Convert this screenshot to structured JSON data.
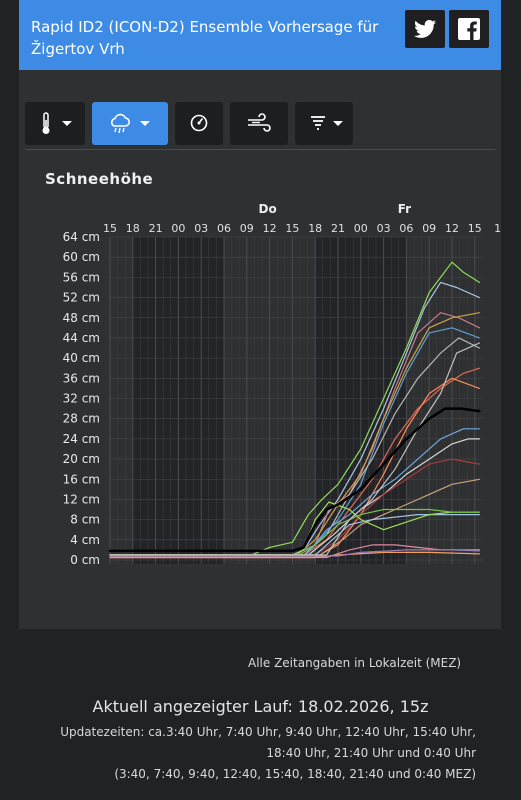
{
  "header": {
    "title": "Rapid ID2 (ICON-D2) Ensemble Vorhersage für Žigertov Vrh"
  },
  "social": {
    "twitter_icon": "twitter-icon",
    "facebook_icon": "facebook-icon"
  },
  "toolbar": {
    "items": [
      {
        "icon": "thermometer-icon",
        "active": false,
        "dropdown": true
      },
      {
        "icon": "snow-cloud-icon",
        "active": true,
        "dropdown": true
      },
      {
        "icon": "pressure-gauge-icon",
        "active": false,
        "dropdown": false
      },
      {
        "icon": "wind-icon",
        "active": false,
        "dropdown": false
      },
      {
        "icon": "gust-icon",
        "active": false,
        "dropdown": true
      }
    ],
    "accent_color": "#3e8be6"
  },
  "chart_data": {
    "type": "line",
    "title": "Schneehöhe",
    "day_labels": [
      {
        "label": "Do",
        "tick_index": 7
      },
      {
        "label": "Fr",
        "tick_index": 13
      }
    ],
    "x_ticks": [
      "15",
      "18",
      "21",
      "00",
      "03",
      "06",
      "09",
      "12",
      "15",
      "18",
      "21",
      "00",
      "03",
      "06",
      "09",
      "12",
      "15",
      "1"
    ],
    "y_ticks": [
      "0 cm",
      "4 cm",
      "8 cm",
      "12 cm",
      "16 cm",
      "20 cm",
      "24 cm",
      "28 cm",
      "32 cm",
      "36 cm",
      "40 cm",
      "44 cm",
      "48 cm",
      "52 cm",
      "56 cm",
      "60 cm",
      "64 cm"
    ],
    "ylim": [
      0,
      64
    ],
    "xlim": [
      0,
      16.3
    ],
    "grid": true,
    "series": [
      {
        "color": "#000000",
        "width": 2.5,
        "points": [
          [
            0,
            1.8
          ],
          [
            8,
            1.8
          ],
          [
            8.5,
            2.5
          ],
          [
            9,
            7
          ],
          [
            9.5,
            10
          ],
          [
            10,
            11
          ],
          [
            11,
            14
          ],
          [
            12,
            19
          ],
          [
            13,
            24
          ],
          [
            14,
            28
          ],
          [
            14.7,
            30
          ],
          [
            15.4,
            30
          ],
          [
            16.2,
            29.5
          ]
        ]
      },
      {
        "color": "#8fdc5a",
        "points": [
          [
            0,
            1
          ],
          [
            6.2,
            1
          ],
          [
            7,
            2.5
          ],
          [
            8,
            3.5
          ],
          [
            8.7,
            9
          ],
          [
            9.3,
            12
          ],
          [
            10,
            15
          ],
          [
            11,
            22
          ],
          [
            12,
            32
          ],
          [
            13,
            42
          ],
          [
            14,
            53
          ],
          [
            15,
            59
          ],
          [
            15.5,
            57
          ],
          [
            16.2,
            55
          ]
        ]
      },
      {
        "color": "#a9c4e4",
        "points": [
          [
            0,
            1
          ],
          [
            8,
            1
          ],
          [
            8.5,
            2
          ],
          [
            9.2,
            7
          ],
          [
            10,
            12
          ],
          [
            11,
            20
          ],
          [
            12,
            30
          ],
          [
            13,
            41
          ],
          [
            13.8,
            50
          ],
          [
            14.5,
            55
          ],
          [
            15.2,
            54
          ],
          [
            16.2,
            52
          ]
        ]
      },
      {
        "color": "#c77b8c",
        "points": [
          [
            0,
            1
          ],
          [
            8,
            1
          ],
          [
            9,
            3
          ],
          [
            9.6,
            10
          ],
          [
            10.5,
            13
          ],
          [
            11.5,
            22
          ],
          [
            12.5,
            34
          ],
          [
            13.5,
            45
          ],
          [
            14.5,
            49
          ],
          [
            15.3,
            48
          ],
          [
            16.2,
            46
          ]
        ]
      },
      {
        "color": "#d0a24a",
        "points": [
          [
            0,
            1
          ],
          [
            8.2,
            1
          ],
          [
            9,
            4
          ],
          [
            10,
            11
          ],
          [
            11,
            17
          ],
          [
            12,
            28
          ],
          [
            13,
            38
          ],
          [
            14,
            46
          ],
          [
            15,
            48
          ],
          [
            16.2,
            49
          ]
        ]
      },
      {
        "color": "#5f9fd0",
        "points": [
          [
            0,
            1
          ],
          [
            8,
            1
          ],
          [
            9,
            3
          ],
          [
            10,
            8
          ],
          [
            11,
            15
          ],
          [
            12,
            27
          ],
          [
            13,
            37
          ],
          [
            14,
            45
          ],
          [
            15,
            46
          ],
          [
            16.2,
            44
          ]
        ]
      },
      {
        "color": "#b8b8b8",
        "points": [
          [
            0,
            1
          ],
          [
            8.5,
            1
          ],
          [
            9.5,
            5
          ],
          [
            10.5,
            13
          ],
          [
            11.5,
            20
          ],
          [
            12.5,
            29
          ],
          [
            13.5,
            36
          ],
          [
            14.5,
            41
          ],
          [
            15.3,
            44
          ],
          [
            16.2,
            42
          ]
        ]
      },
      {
        "color": "#e06a55",
        "points": [
          [
            0,
            1
          ],
          [
            8.5,
            1
          ],
          [
            9.5,
            4
          ],
          [
            10.5,
            10
          ],
          [
            11.5,
            16
          ],
          [
            12.5,
            24
          ],
          [
            13.5,
            30
          ],
          [
            14.5,
            34
          ],
          [
            15.5,
            37
          ],
          [
            16.2,
            38
          ]
        ]
      },
      {
        "color": "#ff8a5a",
        "points": [
          [
            0,
            0.5
          ],
          [
            9,
            0.5
          ],
          [
            10,
            3
          ],
          [
            11,
            9
          ],
          [
            12,
            17
          ],
          [
            13,
            26
          ],
          [
            14,
            33
          ],
          [
            15,
            36
          ],
          [
            16.2,
            34
          ]
        ]
      },
      {
        "color": "#6fa8dc",
        "points": [
          [
            0,
            1
          ],
          [
            8.6,
            1
          ],
          [
            9.5,
            6
          ],
          [
            10.5,
            9
          ],
          [
            11.5,
            13
          ],
          [
            12.5,
            16
          ],
          [
            13.5,
            20
          ],
          [
            14.5,
            24
          ],
          [
            15.5,
            26
          ],
          [
            16.2,
            26
          ]
        ]
      },
      {
        "color": "#d8d8d8",
        "points": [
          [
            0,
            1
          ],
          [
            8.7,
            1
          ],
          [
            9.8,
            5
          ],
          [
            11,
            10
          ],
          [
            12,
            13
          ],
          [
            13,
            17
          ],
          [
            14,
            20
          ],
          [
            15,
            23
          ],
          [
            15.7,
            24
          ],
          [
            16.2,
            24
          ]
        ]
      },
      {
        "color": "#a83b3b",
        "points": [
          [
            0,
            1
          ],
          [
            9,
            1
          ],
          [
            10,
            4
          ],
          [
            11,
            9
          ],
          [
            12,
            13
          ],
          [
            13,
            16
          ],
          [
            14,
            19
          ],
          [
            15,
            20
          ],
          [
            16.2,
            19
          ]
        ]
      },
      {
        "color": "#c8a37a",
        "points": [
          [
            0,
            1
          ],
          [
            9.2,
            1
          ],
          [
            10.2,
            4
          ],
          [
            11,
            7
          ],
          [
            12,
            9
          ],
          [
            13,
            11
          ],
          [
            14,
            13
          ],
          [
            15,
            15
          ],
          [
            16.2,
            16
          ]
        ]
      },
      {
        "color": "#9ec3e6",
        "points": [
          [
            0,
            1
          ],
          [
            9,
            1
          ],
          [
            10,
            5
          ],
          [
            10.5,
            7
          ],
          [
            11.5,
            8
          ],
          [
            12.5,
            8.5
          ],
          [
            13.5,
            9
          ],
          [
            14.5,
            9
          ],
          [
            15.5,
            9
          ],
          [
            16.2,
            9
          ]
        ]
      },
      {
        "color": "#9be05a",
        "points": [
          [
            0,
            1
          ],
          [
            8,
            1
          ],
          [
            8.5,
            2
          ],
          [
            9,
            8
          ],
          [
            9.6,
            11.5
          ],
          [
            10.5,
            10
          ],
          [
            11,
            8
          ],
          [
            12,
            6
          ],
          [
            13,
            7.5
          ],
          [
            14,
            9
          ],
          [
            15,
            9.5
          ],
          [
            16.2,
            9.5
          ]
        ]
      },
      {
        "color": "#7cc04a",
        "points": [
          [
            0,
            1
          ],
          [
            8.3,
            1
          ],
          [
            9,
            3
          ],
          [
            10,
            7
          ],
          [
            11,
            9
          ],
          [
            12,
            10
          ],
          [
            13,
            10
          ],
          [
            14,
            10
          ],
          [
            15,
            9.5
          ],
          [
            16.2,
            9.5
          ]
        ]
      },
      {
        "color": "#e08aa0",
        "points": [
          [
            0,
            0.5
          ],
          [
            9.5,
            0.5
          ],
          [
            10.5,
            2
          ],
          [
            11.5,
            3
          ],
          [
            12.5,
            3
          ],
          [
            13.5,
            2.5
          ],
          [
            14.5,
            2
          ],
          [
            16.2,
            2
          ]
        ]
      },
      {
        "color": "#f0a060",
        "points": [
          [
            0,
            0.5
          ],
          [
            9,
            0.5
          ],
          [
            10,
            1
          ],
          [
            12,
            1.5
          ],
          [
            14,
            1.5
          ],
          [
            16.2,
            1.2
          ]
        ]
      },
      {
        "color": "#9a7ab8",
        "points": [
          [
            0,
            0.8
          ],
          [
            10,
            0.8
          ],
          [
            11,
            1.5
          ],
          [
            13,
            2
          ],
          [
            15,
            2
          ],
          [
            16.2,
            1.8
          ]
        ]
      },
      {
        "color": "#c0c0c0",
        "points": [
          [
            0,
            1
          ],
          [
            9.5,
            1
          ],
          [
            10.5,
            8
          ],
          [
            11.5,
            12
          ],
          [
            12.5,
            18
          ],
          [
            13.5,
            26
          ],
          [
            14.5,
            33
          ],
          [
            15.2,
            41
          ],
          [
            16.2,
            43
          ]
        ]
      }
    ]
  },
  "footer": {
    "time_zone_note": "Alle Zeitangaben in Lokalzeit (MEZ)",
    "current_run": "Aktuell angezeigter Lauf: 18.02.2026, 15z",
    "update_times_line1": "Updatezeiten: ca.3:40 Uhr, 7:40 Uhr, 9:40 Uhr, 12:40 Uhr, 15:40 Uhr,",
    "update_times_line2": "18:40 Uhr, 21:40 Uhr und 0:40 Uhr",
    "update_times_line3": "(3:40, 7:40, 9:40, 12:40, 15:40, 18:40, 21:40 und 0:40 MEZ)"
  }
}
